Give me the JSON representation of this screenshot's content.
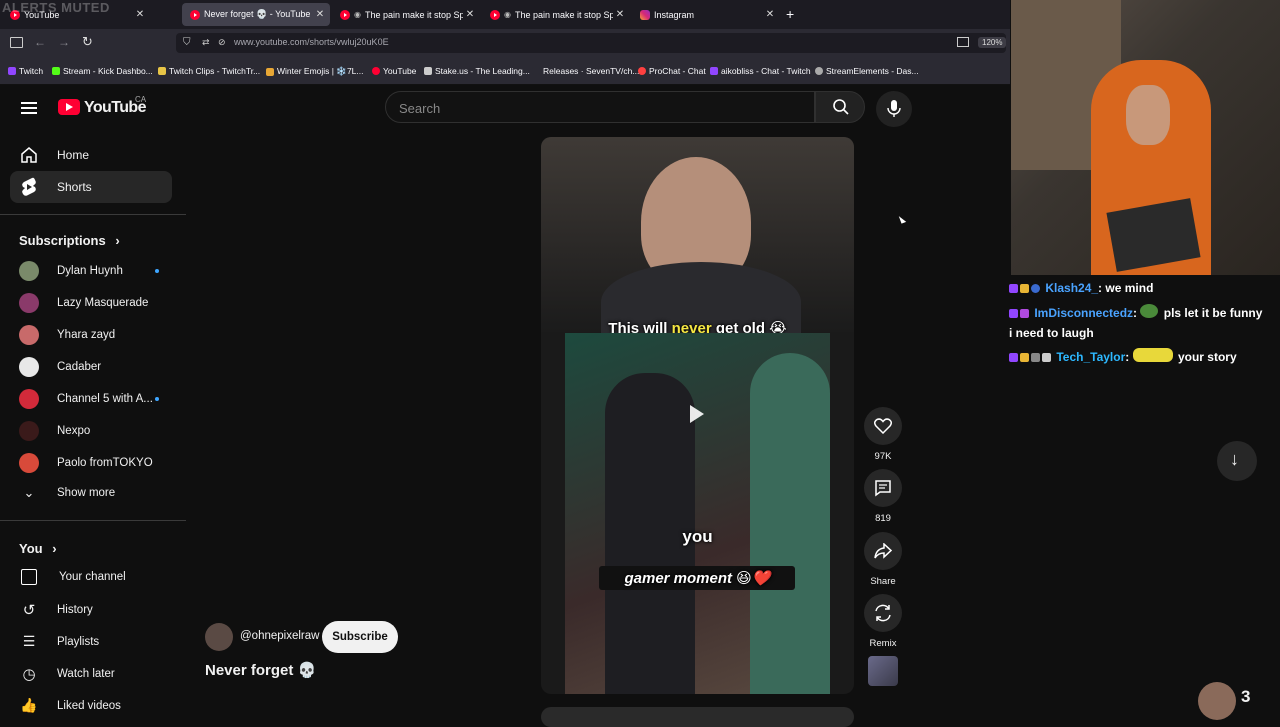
{
  "browser": {
    "overlay_text": "ALERTS MUTED",
    "tabs": [
      {
        "label": "YouTube",
        "active": false
      },
      {
        "label": "Never forget 💀 - YouTube",
        "active": true
      },
      {
        "label": "The pain make it stop Spide",
        "active": false
      },
      {
        "label": "The pain make it stop Spide",
        "active": false
      },
      {
        "label": "Instagram",
        "active": false
      }
    ],
    "new_tab": "+",
    "url": "www.youtube.com/shorts/vwluj20uK0E",
    "zoom": "120%",
    "bookmarks": [
      {
        "label": "Twitch",
        "color": "#9146ff"
      },
      {
        "label": "Stream - Kick Dashbo...",
        "color": "#53fc18"
      },
      {
        "label": "Twitch Clips - TwitchTr...",
        "color": "#e8c547"
      },
      {
        "label": "Winter Emojis | ❄️7L...",
        "color": "#e8a735"
      },
      {
        "label": "YouTube",
        "color": "#ff0033"
      },
      {
        "label": "Stake.us - The Leading...",
        "color": "#cccccc"
      },
      {
        "label": "Releases · SevenTV/ch...",
        "color": "#2b2a33"
      },
      {
        "label": "ProChat - Chat",
        "color": "#ff4040"
      },
      {
        "label": "aikobliss - Chat - Twitch",
        "color": "#9146ff"
      },
      {
        "label": "StreamElements - Das...",
        "color": "#aaaaaa"
      }
    ]
  },
  "youtube": {
    "logo_text": "YouTube",
    "country": "CA",
    "search_placeholder": "Search",
    "nav": [
      {
        "label": "Home",
        "icon": "home-icon"
      },
      {
        "label": "Shorts",
        "icon": "shorts-icon",
        "selected": true
      }
    ],
    "subscriptions_header": "Subscriptions",
    "subscriptions": [
      {
        "name": "Dylan Huynh",
        "new": true,
        "color": "#7a8a6a"
      },
      {
        "name": "Lazy Masquerade",
        "new": false,
        "color": "#8a3a6a"
      },
      {
        "name": "Yhara zayd",
        "new": false,
        "color": "#c86a6a"
      },
      {
        "name": "Cadaber",
        "new": false,
        "color": "#e8e8e8"
      },
      {
        "name": "Channel 5 with A...",
        "new": true,
        "color": "#d22a3a"
      },
      {
        "name": "Nexpo",
        "new": false,
        "color": "#3a1a1a"
      },
      {
        "name": "Paolo fromTOKYO",
        "new": false,
        "color": "#d84a3a"
      }
    ],
    "show_more": "Show more",
    "you_header": "You",
    "you_items": [
      {
        "label": "Your channel",
        "icon": "your-channel-icon"
      },
      {
        "label": "History",
        "icon": "history-icon"
      },
      {
        "label": "Playlists",
        "icon": "playlists-icon"
      },
      {
        "label": "Watch later",
        "icon": "watch-later-icon"
      },
      {
        "label": "Liked videos",
        "icon": "liked-videos-icon"
      }
    ],
    "short": {
      "channel": "@ohnepixelraw",
      "subscribe": "Subscribe",
      "title": "Never forget 💀",
      "caption_top_a": "This will ",
      "caption_top_b": "never",
      "caption_top_c": " get old 😭",
      "caption_you": "you",
      "caption_gamer": "gamer moment 😆❤️",
      "likes": "97K",
      "comments": "819",
      "share": "Share",
      "remix": "Remix"
    }
  },
  "stream": {
    "chat": [
      {
        "user": "Klash24_",
        "color": "#4aa3ff",
        "message": "we mind"
      },
      {
        "user": "ImDisconnectedz",
        "color": "#4aa3ff",
        "message": "pls let it be funny"
      },
      {
        "user": "",
        "color": "#ffffff",
        "message": "i need to laugh"
      },
      {
        "user": "Tech_Taylor",
        "color": "#2db8ff",
        "message": "your story"
      }
    ],
    "viewer_count": "3"
  }
}
